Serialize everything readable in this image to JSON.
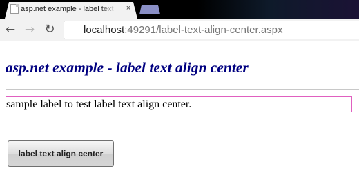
{
  "browser": {
    "tab": {
      "title": "asp.net example - label text align center",
      "close_glyph": "×"
    },
    "icons": {
      "back": "back-arrow-icon",
      "forward": "forward-arrow-icon",
      "reload": "reload-icon",
      "favicon": "page-icon"
    },
    "address": {
      "host": "localhost",
      "rest": ":49291/label-text-align-center.aspx"
    }
  },
  "page": {
    "heading": "asp.net example - label text align center",
    "sample_label": "sample label to test label text align center.",
    "button_label": "label text align center"
  },
  "colors": {
    "heading": "#000080",
    "label_border": "#e060c0"
  }
}
